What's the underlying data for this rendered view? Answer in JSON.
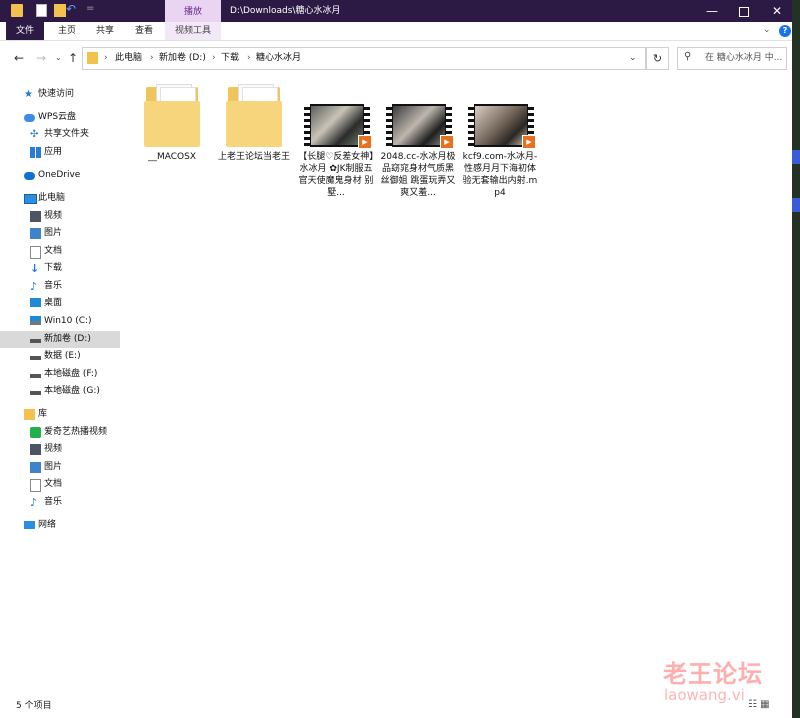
{
  "titlebar": {
    "context_tab": "播放",
    "path": "D:\\Downloads\\糖心水冰月",
    "minimize": "—",
    "close": "✕"
  },
  "ribbon": {
    "tabs": [
      "文件",
      "主页",
      "共享",
      "查看",
      "视频工具"
    ],
    "help": "?"
  },
  "address": {
    "crumbs": [
      "此电脑",
      "新加卷 (D:)",
      "下载",
      "糖心水冰月"
    ],
    "search_placeholder": "在 糖心水冰月 中..."
  },
  "nav_pane": {
    "items": [
      {
        "label": "快速访问",
        "icon": "star-icon"
      },
      {
        "label": "WPS云盘",
        "icon": "cloud-icon"
      },
      {
        "label": "共享文件夹",
        "icon": "share-icon"
      },
      {
        "label": "应用",
        "icon": "apps-icon"
      },
      {
        "label": "OneDrive",
        "icon": "onedrive-icon"
      },
      {
        "label": "此电脑",
        "icon": "pc-icon"
      },
      {
        "label": "视频",
        "icon": "video-icon"
      },
      {
        "label": "图片",
        "icon": "picture-icon"
      },
      {
        "label": "文档",
        "icon": "document-icon"
      },
      {
        "label": "下载",
        "icon": "download-icon"
      },
      {
        "label": "音乐",
        "icon": "music-icon"
      },
      {
        "label": "桌面",
        "icon": "desktop-icon"
      },
      {
        "label": "Win10 (C:)",
        "icon": "windows-drive-icon"
      },
      {
        "label": "新加卷 (D:)",
        "icon": "drive-icon"
      },
      {
        "label": "数据 (E:)",
        "icon": "drive-icon"
      },
      {
        "label": "本地磁盘 (F:)",
        "icon": "drive-icon"
      },
      {
        "label": "本地磁盘 (G:)",
        "icon": "drive-icon"
      },
      {
        "label": "库",
        "icon": "library-icon"
      },
      {
        "label": "爱奇艺热播视频",
        "icon": "iqiyi-icon"
      },
      {
        "label": "视频",
        "icon": "video-icon"
      },
      {
        "label": "图片",
        "icon": "picture-icon"
      },
      {
        "label": "文档",
        "icon": "document-icon"
      },
      {
        "label": "音乐",
        "icon": "music-icon"
      },
      {
        "label": "网络",
        "icon": "network-icon"
      }
    ],
    "selected": "新加卷 (D:)"
  },
  "files": [
    {
      "name": "__MACOSX",
      "type": "folder"
    },
    {
      "name": "上老王论坛当老王",
      "type": "folder"
    },
    {
      "name": "【长腿♡反差女神】水冰月 ✿JK制服五官天使魔鬼身材 别墅...",
      "type": "video"
    },
    {
      "name": "2048.cc-水冰月极品窈窕身材气质黑丝御姐 跳蛋玩弄又爽又羞...",
      "type": "video"
    },
    {
      "name": "kcf9.com-水冰月-性感月月下海初体验无套输出内射.mp4",
      "type": "video"
    }
  ],
  "status": {
    "count_text": "5 个项目"
  },
  "watermark": {
    "title": "老王论坛",
    "url": "laowang.vi"
  },
  "colors": {
    "titlebar": "#2d1a44",
    "context_tab": "#e9d4f2",
    "selection": "#d9d9d9",
    "folder": "#f6d57c"
  }
}
